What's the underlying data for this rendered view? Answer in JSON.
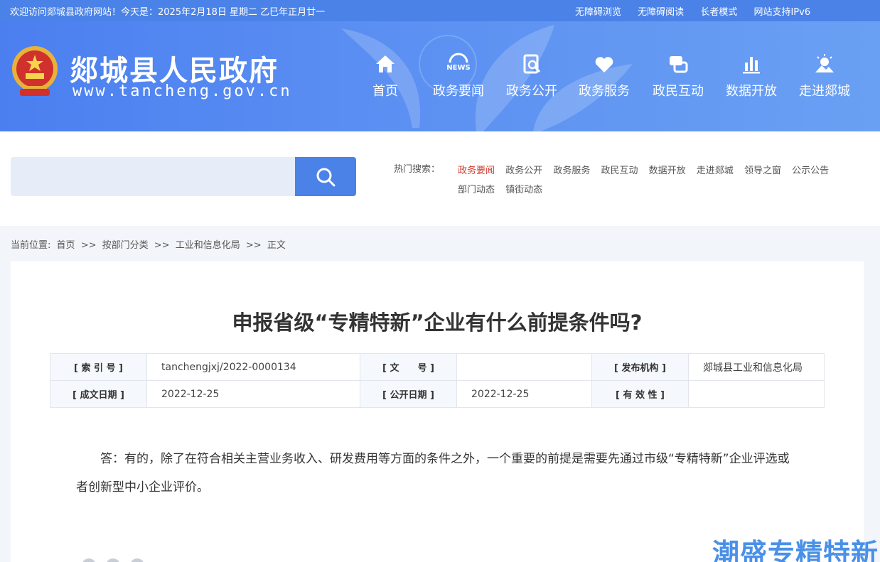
{
  "topbar": {
    "welcome": "欢迎访问郯城县政府网站！今天是：2025年2月18日  星期二  乙巳年正月廿一",
    "links": [
      "无障碍浏览",
      "无障碍阅读",
      "长者模式",
      "网站支持IPv6"
    ]
  },
  "header": {
    "site_title": "郯城县人民政府",
    "site_url": "www.tancheng.gov.cn",
    "nav": [
      {
        "label": "首页",
        "icon": "home-icon"
      },
      {
        "label": "政务要闻",
        "icon": "news-icon"
      },
      {
        "label": "政务公开",
        "icon": "document-search-icon"
      },
      {
        "label": "政务服务",
        "icon": "heart-hand-icon"
      },
      {
        "label": "政民互动",
        "icon": "chat-icon"
      },
      {
        "label": "数据开放",
        "icon": "bar-chart-icon"
      },
      {
        "label": "走进郯城",
        "icon": "sun-mountain-icon"
      }
    ],
    "news_icon_text": "NEWS"
  },
  "search": {
    "placeholder": "",
    "hot_label": "热门搜索：",
    "hot_items": [
      "政务要闻",
      "政务公开",
      "政务服务",
      "政民互动",
      "数据开放",
      "走进郯城",
      "领导之窗",
      "公示公告",
      "部门动态",
      "镇街动态"
    ]
  },
  "breadcrumb": {
    "prefix": "当前位置:",
    "items": [
      "首页",
      ">>",
      "按部门分类",
      ">>",
      "工业和信息化局",
      ">>",
      "正文"
    ]
  },
  "article": {
    "title": "申报省级“专精特新”企业有什么前提条件吗?",
    "meta": {
      "index_key": "[ 索 引 号 ]",
      "index_val": "tanchengjxj/2022-0000134",
      "doc_key": "[ 文　　号 ]",
      "doc_val": "",
      "org_key": "[ 发布机构 ]",
      "org_val": "郯城县工业和信息化局",
      "created_key": "[ 成文日期 ]",
      "created_val": "2022-12-25",
      "published_key": "[ 公开日期 ]",
      "published_val": "2022-12-25",
      "valid_key": "[ 有 效 性 ]",
      "valid_val": ""
    },
    "body": "答：有的，除了在符合相关主营业务收入、研发费用等方面的条件之外，一个重要的前提是需要先通过市级“专精特新”企业评选或者创新型中小企业评价。"
  },
  "watermark": "潮盛专精特新",
  "colors": {
    "accent": "#4a82e8",
    "hot_active": "#d23b2f"
  }
}
